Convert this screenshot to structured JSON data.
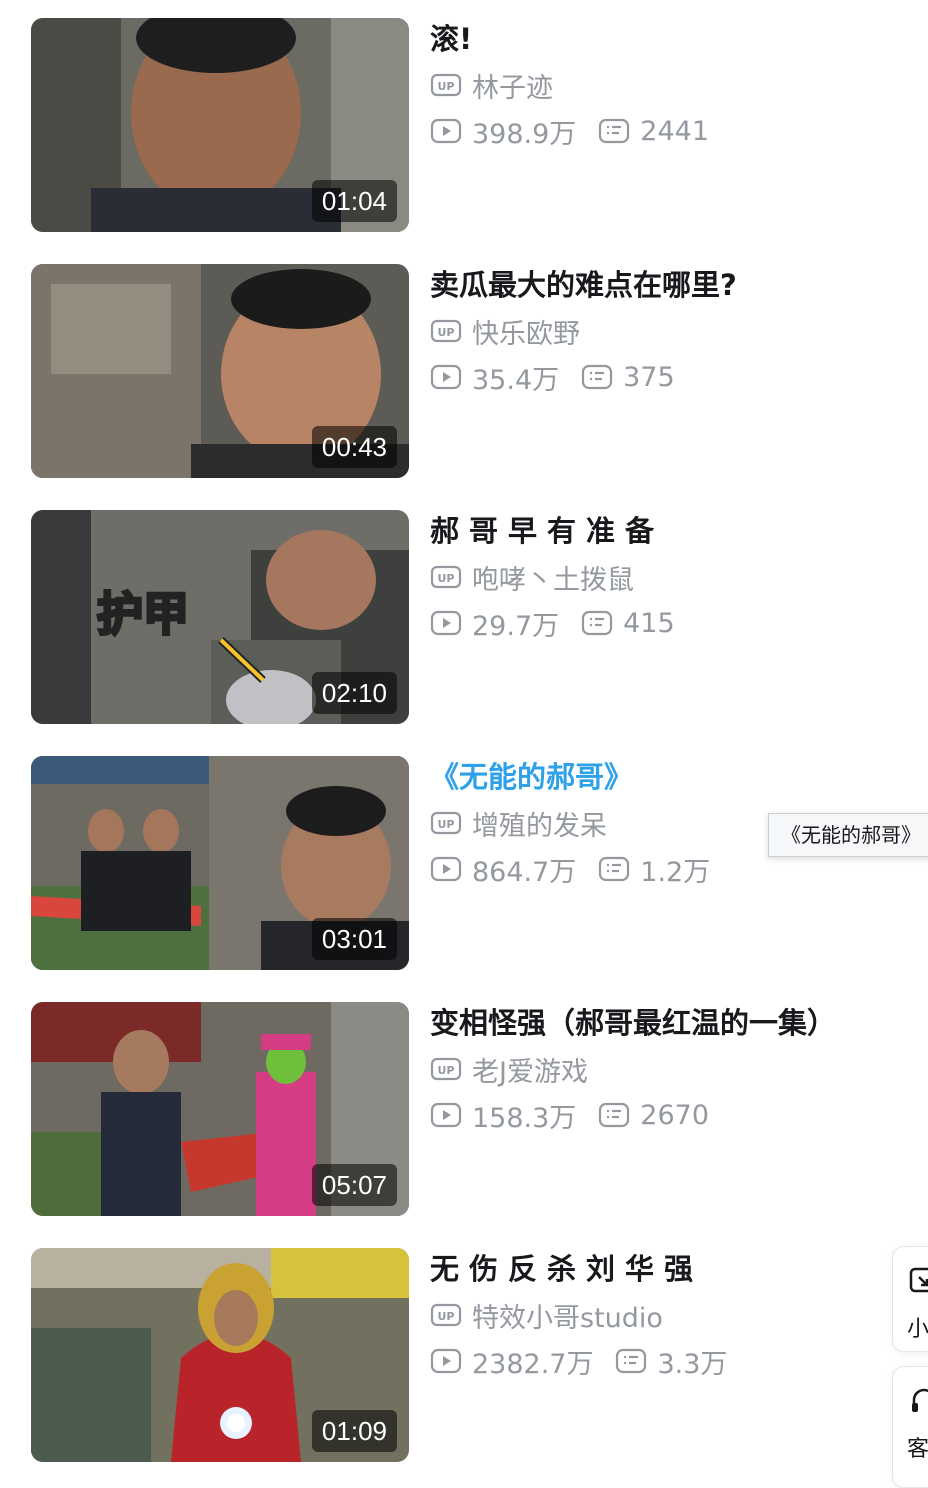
{
  "videos": [
    {
      "title": "滚!",
      "duration": "01:04",
      "up_label": "UP",
      "uploader": "林子迹",
      "views": "398.9万",
      "danmaku": "2441",
      "active": false,
      "spaced": false
    },
    {
      "title": "卖瓜最大的难点在哪里?",
      "duration": "00:43",
      "up_label": "UP",
      "uploader": "快乐欧野",
      "views": "35.4万",
      "danmaku": "375",
      "active": false,
      "spaced": false
    },
    {
      "title": "郝哥早有准备",
      "duration": "02:10",
      "up_label": "UP",
      "uploader": "咆哮丶土拨鼠",
      "views": "29.7万",
      "danmaku": "415",
      "active": false,
      "spaced": true
    },
    {
      "title": "《无能的郝哥》",
      "duration": "03:01",
      "up_label": "UP",
      "uploader": "增殖的发呆",
      "views": "864.7万",
      "danmaku": "1.2万",
      "active": true,
      "spaced": false
    },
    {
      "title": "变相怪强（郝哥最红温的一集）",
      "duration": "05:07",
      "up_label": "UP",
      "uploader": "老J爱游戏",
      "views": "158.3万",
      "danmaku": "2670",
      "active": false,
      "spaced": false
    },
    {
      "title": "无伤反杀刘华强",
      "duration": "01:09",
      "up_label": "UP",
      "uploader": "特效小哥studio",
      "views": "2382.7万",
      "danmaku": "3.3万",
      "active": false,
      "spaced": true
    }
  ],
  "tooltip": "《无能的郝哥》",
  "side_buttons": [
    {
      "label": "小",
      "icon": "mini-window-icon"
    },
    {
      "label": "客",
      "icon": "headset-icon"
    }
  ],
  "colors": {
    "accent": "#2ea1e8",
    "meta": "#9499a0",
    "title": "#18191c"
  }
}
